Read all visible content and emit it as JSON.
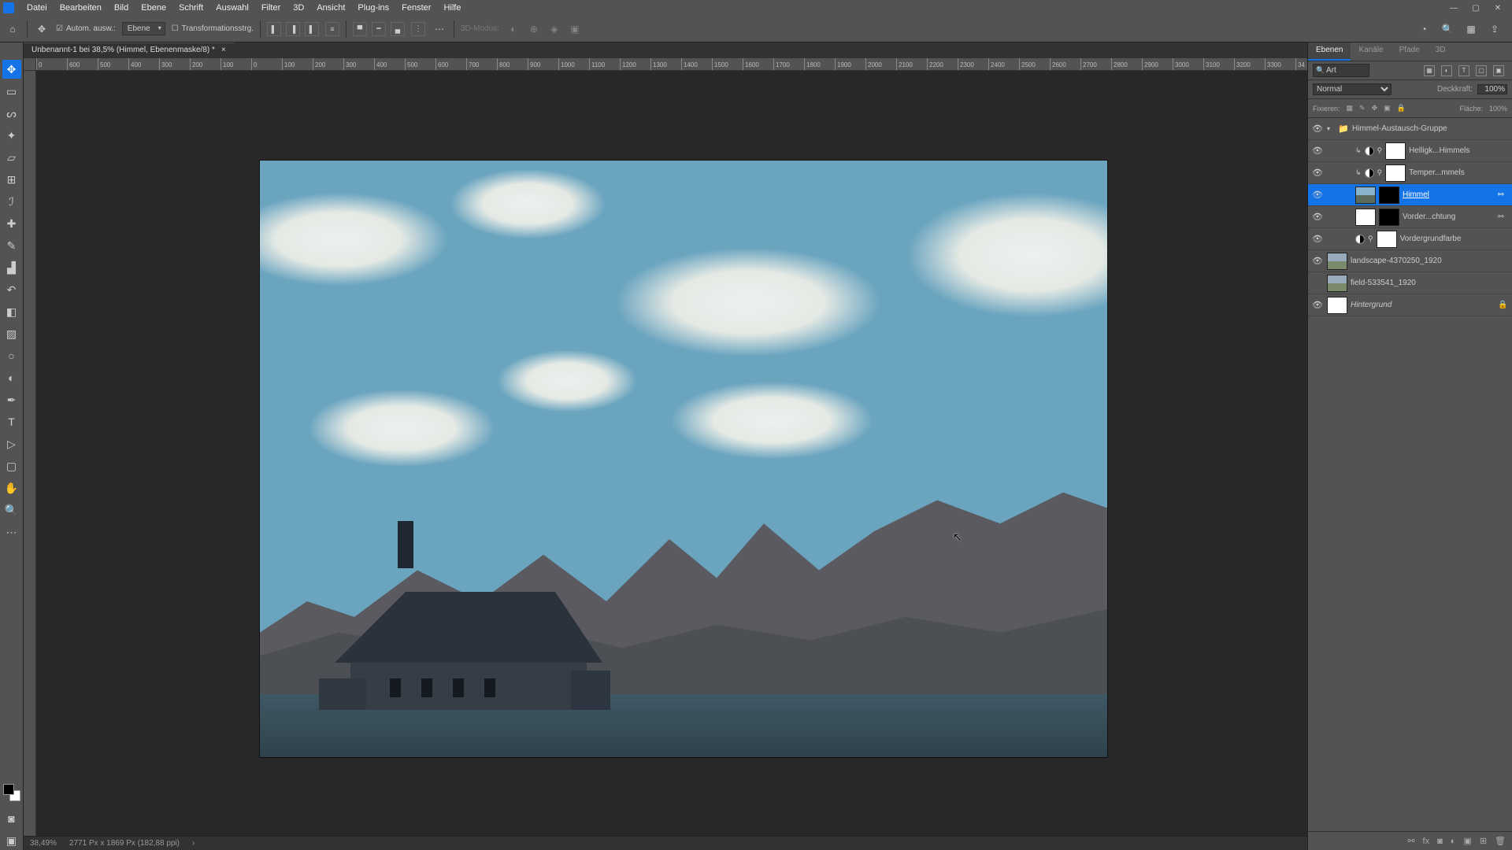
{
  "menubar": {
    "items": [
      "Datei",
      "Bearbeiten",
      "Bild",
      "Ebene",
      "Schrift",
      "Auswahl",
      "Filter",
      "3D",
      "Ansicht",
      "Plug-ins",
      "Fenster",
      "Hilfe"
    ]
  },
  "window_controls": {
    "min": "—",
    "max": "▢",
    "close": "✕"
  },
  "options": {
    "auto_select": "Autom. ausw.:",
    "layer_select": "Ebene",
    "transform": "Transformationsstrg.",
    "mode_3d": "3D-Modus:"
  },
  "doc_tab": {
    "title": "Unbenannt-1 bei 38,5% (Himmel, Ebenenmaske/8) *",
    "close": "×"
  },
  "ruler_h": [
    "0",
    "600",
    "500",
    "400",
    "300",
    "200",
    "100",
    "0",
    "100",
    "200",
    "300",
    "400",
    "500",
    "600",
    "700",
    "800",
    "900",
    "1000",
    "1100",
    "1200",
    "1300",
    "1400",
    "1500",
    "1600",
    "1700",
    "1800",
    "1900",
    "2000",
    "2100",
    "2200",
    "2300",
    "2400",
    "2500",
    "2600",
    "2700",
    "2800",
    "2900",
    "3000",
    "3100",
    "3200",
    "3300",
    "34"
  ],
  "status": {
    "zoom": "38,49%",
    "doc": "2771 Px x 1869 Px (182,88 ppi)",
    "more": "›"
  },
  "panel_tabs": [
    "Ebenen",
    "Kanäle",
    "Pfade",
    "3D"
  ],
  "search": {
    "placeholder": "Art"
  },
  "blend": {
    "mode": "Normal",
    "opacity_label": "Deckkraft:",
    "opacity": "100%",
    "lock_label": "Fixieren:",
    "fill_label": "Fläche:",
    "fill": "100%"
  },
  "layers": {
    "group": "Himmel-Austausch-Gruppe",
    "items": [
      {
        "name": "Helligk...Himmels",
        "adj": true,
        "mask": "white"
      },
      {
        "name": "Temper...mmels",
        "adj": true,
        "mask": "white"
      },
      {
        "name": "Himmel",
        "thumb": "img",
        "mask": "black",
        "selected": true,
        "link": true
      },
      {
        "name": "Vorder...chtung",
        "thumb": "white",
        "mask": "black",
        "link": true
      },
      {
        "name": "Vordergrundfarbe",
        "adj": true,
        "mask": "white"
      }
    ],
    "top": [
      {
        "name": "landscape-4370250_1920",
        "thumb": "img2",
        "vis": true
      },
      {
        "name": "field-533541_1920",
        "thumb": "img2",
        "vis": false
      },
      {
        "name": "Hintergrund",
        "thumb": "white",
        "vis": true,
        "locked": true,
        "italic": true
      }
    ]
  }
}
